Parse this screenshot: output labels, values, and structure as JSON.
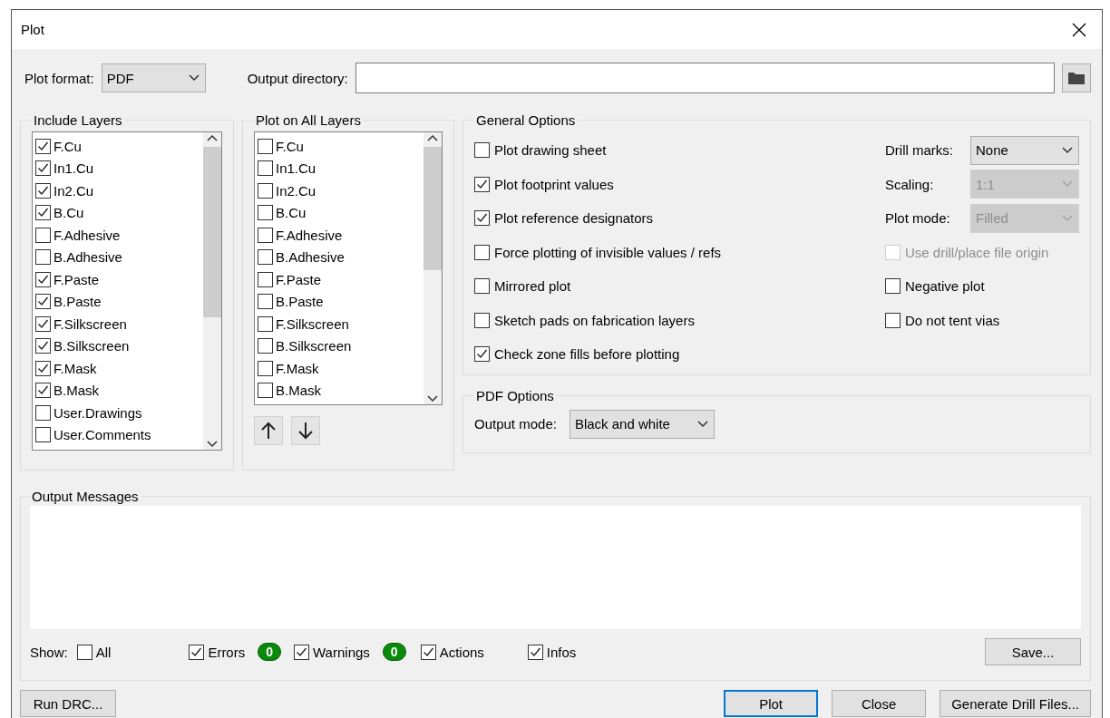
{
  "window": {
    "title": "Plot"
  },
  "plot_format": {
    "label": "Plot format:",
    "value": "PDF"
  },
  "output_directory": {
    "label": "Output directory:"
  },
  "include_layers": {
    "title": "Include Layers",
    "items": [
      {
        "label": "F.Cu",
        "checked": true
      },
      {
        "label": "In1.Cu",
        "checked": true
      },
      {
        "label": "In2.Cu",
        "checked": true
      },
      {
        "label": "B.Cu",
        "checked": true
      },
      {
        "label": "F.Adhesive",
        "checked": false
      },
      {
        "label": "B.Adhesive",
        "checked": false
      },
      {
        "label": "F.Paste",
        "checked": true
      },
      {
        "label": "B.Paste",
        "checked": true
      },
      {
        "label": "F.Silkscreen",
        "checked": true
      },
      {
        "label": "B.Silkscreen",
        "checked": true
      },
      {
        "label": "F.Mask",
        "checked": true
      },
      {
        "label": "B.Mask",
        "checked": true
      },
      {
        "label": "User.Drawings",
        "checked": false
      },
      {
        "label": "User.Comments",
        "checked": false
      }
    ]
  },
  "plot_on_all_layers": {
    "title": "Plot on All Layers",
    "items": [
      {
        "label": "F.Cu",
        "checked": false
      },
      {
        "label": "In1.Cu",
        "checked": false
      },
      {
        "label": "In2.Cu",
        "checked": false
      },
      {
        "label": "B.Cu",
        "checked": false
      },
      {
        "label": "F.Adhesive",
        "checked": false
      },
      {
        "label": "B.Adhesive",
        "checked": false
      },
      {
        "label": "F.Paste",
        "checked": false
      },
      {
        "label": "B.Paste",
        "checked": false
      },
      {
        "label": "F.Silkscreen",
        "checked": false
      },
      {
        "label": "B.Silkscreen",
        "checked": false
      },
      {
        "label": "F.Mask",
        "checked": false
      },
      {
        "label": "B.Mask",
        "checked": false
      }
    ]
  },
  "general_options": {
    "title": "General Options",
    "options": [
      {
        "label": "Plot drawing sheet",
        "checked": false
      },
      {
        "label": "Plot footprint values",
        "checked": true
      },
      {
        "label": "Plot reference designators",
        "checked": true
      },
      {
        "label": "Force plotting of invisible values / refs",
        "checked": false
      },
      {
        "label": "Mirrored plot",
        "checked": false
      },
      {
        "label": "Sketch pads on fabrication layers",
        "checked": false
      },
      {
        "label": "Check zone fills before plotting",
        "checked": true
      }
    ],
    "selects": [
      {
        "label": "Drill marks:",
        "value": "None",
        "disabled": false
      },
      {
        "label": "Scaling:",
        "value": "1:1",
        "disabled": true
      },
      {
        "label": "Plot mode:",
        "value": "Filled",
        "disabled": true
      }
    ],
    "right_options": [
      {
        "label": "Use drill/place file origin",
        "checked": false,
        "disabled": true
      },
      {
        "label": "Negative plot",
        "checked": false,
        "disabled": false
      },
      {
        "label": "Do not tent vias",
        "checked": false,
        "disabled": false
      }
    ]
  },
  "pdf_options": {
    "title": "PDF Options",
    "output_mode": {
      "label": "Output mode:",
      "value": "Black and white"
    }
  },
  "output_messages": {
    "title": "Output Messages",
    "show_label": "Show:",
    "filters": [
      {
        "label": "All",
        "checked": false
      },
      {
        "label": "Errors",
        "checked": true,
        "count": "0"
      },
      {
        "label": "Warnings",
        "checked": true,
        "count": "0"
      },
      {
        "label": "Actions",
        "checked": true
      },
      {
        "label": "Infos",
        "checked": true
      }
    ],
    "save_button": "Save..."
  },
  "buttons": [
    {
      "label": "Run DRC...",
      "default": false
    },
    {
      "label": "Plot",
      "default": true
    },
    {
      "label": "Close",
      "default": false
    },
    {
      "label": "Generate Drill Files...",
      "default": false
    }
  ]
}
